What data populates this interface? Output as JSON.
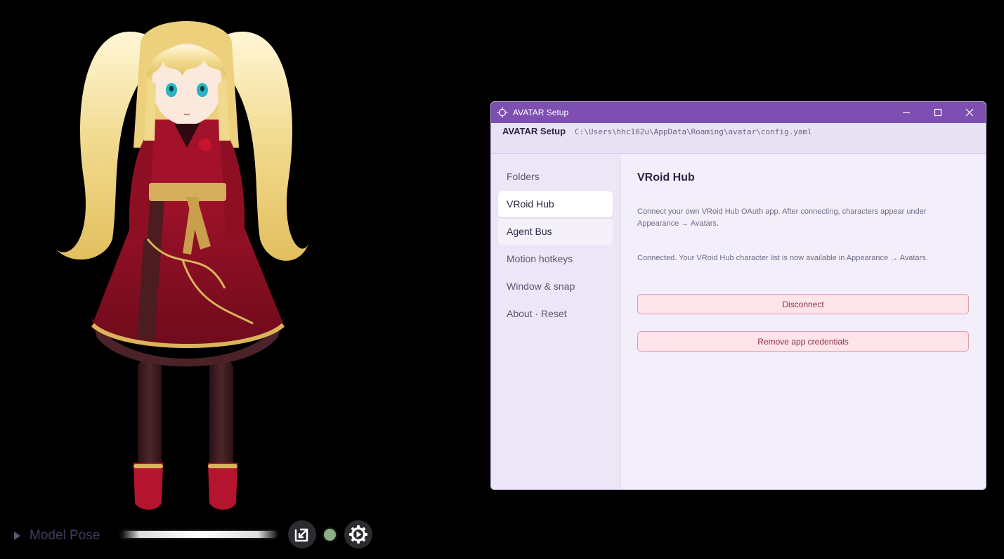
{
  "scene": {
    "model_pose_label": "Model Pose",
    "icons": {
      "expand": "triangle-right-icon",
      "popout": "popout-icon",
      "status": "status-dot",
      "settings": "gear-icon"
    },
    "colors": {
      "status_dot": "#8fae88"
    }
  },
  "window": {
    "title": "AVATAR Setup",
    "controls": {
      "minimize": "minimize-icon",
      "maximize": "maximize-icon",
      "close": "close-icon"
    },
    "colors": {
      "titlebar": "#7d4fb1",
      "accent_danger": "#8c3448"
    }
  },
  "header": {
    "app_name": "AVATAR Setup",
    "config_path": "C:\\Users\\hhc102u\\AppData\\Roaming\\avatar\\config.yaml"
  },
  "sidebar": {
    "items": [
      {
        "label": "Folders",
        "state": "normal"
      },
      {
        "label": "VRoid Hub",
        "state": "active"
      },
      {
        "label": "Agent Bus",
        "state": "hover"
      },
      {
        "label": "Motion hotkeys",
        "state": "normal"
      },
      {
        "label": "Window & snap",
        "state": "normal"
      },
      {
        "label": "About · Reset",
        "state": "normal"
      }
    ]
  },
  "content": {
    "title": "VRoid Hub",
    "description": "Connect your own VRoid Hub OAuth app. After connecting, characters appear under Appearance → Avatars.",
    "status": "Connected. Your VRoid Hub character list is now available in Appearance → Avatars.",
    "disconnect_label": "Disconnect",
    "remove_credentials_label": "Remove app credentials"
  }
}
